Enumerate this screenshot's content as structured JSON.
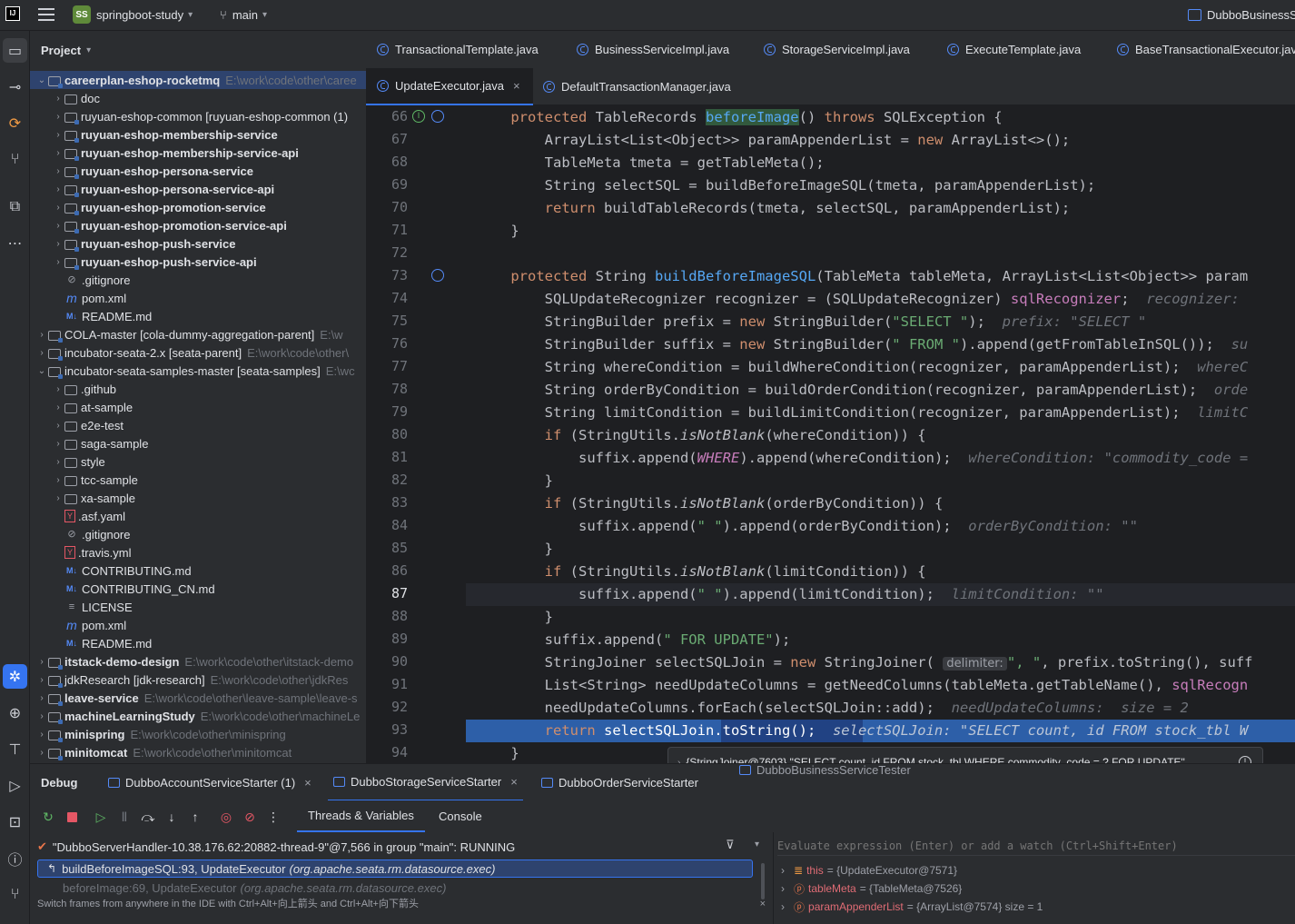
{
  "titlebar": {
    "project_badge": "SS",
    "project_name": "springboot-study",
    "branch": "main",
    "run_config": "DubboBusinessS"
  },
  "project_panel": {
    "title": "Project",
    "tree": [
      {
        "text": "careerplan-eshop-rocketmq",
        "path": "E:\\work\\code\\other\\caree",
        "bold": true,
        "depth": 0,
        "expanded": true,
        "type": "module"
      },
      {
        "text": "doc",
        "depth": 1,
        "type": "folder"
      },
      {
        "text": "ruyuan-eshop-common [ruyuan-eshop-common (1)",
        "depth": 1,
        "type": "module"
      },
      {
        "text": "ruyuan-eshop-membership-service",
        "depth": 1,
        "type": "module",
        "bold": true
      },
      {
        "text": "ruyuan-eshop-membership-service-api",
        "depth": 1,
        "type": "module",
        "bold": true
      },
      {
        "text": "ruyuan-eshop-persona-service",
        "depth": 1,
        "type": "module",
        "bold": true
      },
      {
        "text": "ruyuan-eshop-persona-service-api",
        "depth": 1,
        "type": "module",
        "bold": true
      },
      {
        "text": "ruyuan-eshop-promotion-service",
        "depth": 1,
        "type": "module",
        "bold": true
      },
      {
        "text": "ruyuan-eshop-promotion-service-api",
        "depth": 1,
        "type": "module",
        "bold": true
      },
      {
        "text": "ruyuan-eshop-push-service",
        "depth": 1,
        "type": "module",
        "bold": true
      },
      {
        "text": "ruyuan-eshop-push-service-api",
        "depth": 1,
        "type": "module",
        "bold": true
      },
      {
        "text": ".gitignore",
        "depth": 1,
        "type": "ignore"
      },
      {
        "text": "pom.xml",
        "depth": 1,
        "type": "maven"
      },
      {
        "text": "README.md",
        "depth": 1,
        "type": "md"
      },
      {
        "text": "COLA-master [cola-dummy-aggregation-parent]",
        "path": "E:\\w",
        "depth": 0,
        "type": "module"
      },
      {
        "text": "incubator-seata-2.x [seata-parent]",
        "path": "E:\\work\\code\\other\\",
        "depth": 0,
        "type": "module"
      },
      {
        "text": "incubator-seata-samples-master [seata-samples]",
        "path": "E:\\wc",
        "depth": 0,
        "expanded": true,
        "type": "module"
      },
      {
        "text": ".github",
        "depth": 1,
        "type": "folder"
      },
      {
        "text": "at-sample",
        "depth": 1,
        "type": "folder"
      },
      {
        "text": "e2e-test",
        "depth": 1,
        "type": "folder"
      },
      {
        "text": "saga-sample",
        "depth": 1,
        "type": "folder"
      },
      {
        "text": "style",
        "depth": 1,
        "type": "folder"
      },
      {
        "text": "tcc-sample",
        "depth": 1,
        "type": "folder"
      },
      {
        "text": "xa-sample",
        "depth": 1,
        "type": "folder"
      },
      {
        "text": ".asf.yaml",
        "depth": 1,
        "type": "yaml"
      },
      {
        "text": ".gitignore",
        "depth": 1,
        "type": "ignore"
      },
      {
        "text": ".travis.yml",
        "depth": 1,
        "type": "yaml"
      },
      {
        "text": "CONTRIBUTING.md",
        "depth": 1,
        "type": "md"
      },
      {
        "text": "CONTRIBUTING_CN.md",
        "depth": 1,
        "type": "md"
      },
      {
        "text": "LICENSE",
        "depth": 1,
        "type": "text"
      },
      {
        "text": "pom.xml",
        "depth": 1,
        "type": "maven"
      },
      {
        "text": "README.md",
        "depth": 1,
        "type": "md"
      },
      {
        "text": "itstack-demo-design",
        "path": "E:\\work\\code\\other\\itstack-demo",
        "depth": 0,
        "type": "module",
        "bold": true
      },
      {
        "text": "jdkResearch [jdk-research]",
        "path": "E:\\work\\code\\other\\jdkRes",
        "depth": 0,
        "type": "module"
      },
      {
        "text": "leave-service",
        "path": "E:\\work\\code\\other\\leave-sample\\leave-s",
        "depth": 0,
        "type": "module",
        "bold": true
      },
      {
        "text": "machineLearningStudy",
        "path": "E:\\work\\code\\other\\machineLe",
        "depth": 0,
        "type": "module",
        "bold": true
      },
      {
        "text": "minispring",
        "path": "E:\\work\\code\\other\\minispring",
        "depth": 0,
        "type": "module",
        "bold": true
      },
      {
        "text": "minitomcat",
        "path": "E:\\work\\code\\other\\minitomcat",
        "depth": 0,
        "type": "module",
        "bold": true
      }
    ]
  },
  "editor_tabs_row1": [
    "TransactionalTemplate.java",
    "BusinessServiceImpl.java",
    "StorageServiceImpl.java",
    "ExecuteTemplate.java",
    "BaseTransactionalExecutor.jav"
  ],
  "editor_tabs_row2": [
    "UpdateExecutor.java",
    "DefaultTransactionManager.java"
  ],
  "active_tab_close": "×",
  "code": {
    "line_numbers": [
      "66",
      "67",
      "68",
      "69",
      "70",
      "71",
      "72",
      "73",
      "74",
      "75",
      "76",
      "77",
      "78",
      "79",
      "80",
      "81",
      "82",
      "83",
      "84",
      "85",
      "86",
      "87",
      "88",
      "89",
      "90",
      "91",
      "92",
      "93",
      "94"
    ],
    "current_line": "87",
    "highlighted_line": "93"
  },
  "tooltip": {
    "text": "{StringJoiner@7603} \"SELECT count, id FROM stock_tbl WHERE commodity_code = ? FOR UPDATE\""
  },
  "debug": {
    "title": "Debug",
    "sessions": [
      "DubboAccountServiceStarter (1)",
      "DubboStorageServiceStarter",
      "DubboOrderServiceStarter",
      "DubboBusinessServiceTester"
    ],
    "subtabs": [
      "Threads & Variables",
      "Console"
    ],
    "thread": "\"DubboServerHandler-10.38.176.62:20882-thread-9\"@7,566 in group \"main\": RUNNING",
    "frames": [
      {
        "method": "buildBeforeImageSQL:93, UpdateExecutor",
        "class": "(org.apache.seata.rm.datasource.exec)"
      },
      {
        "method": "beforeImage:69, UpdateExecutor",
        "class": "(org.apache.seata.rm.datasource.exec)"
      }
    ],
    "hint": "Switch frames from anywhere in the IDE with Ctrl+Alt+向上箭头 and Ctrl+Alt+向下箭头",
    "evaluate_placeholder": "Evaluate expression (Enter) or add a watch (Ctrl+Shift+Enter)",
    "variables": [
      {
        "name": "this",
        "value": "= {UpdateExecutor@7571}"
      },
      {
        "name": "tableMeta",
        "value": "= {TableMeta@7526}"
      },
      {
        "name": "paramAppenderList",
        "value": "= {ArrayList@7574}  size = 1"
      }
    ]
  }
}
